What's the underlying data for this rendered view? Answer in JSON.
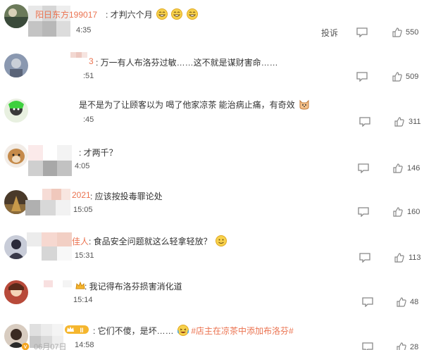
{
  "colors": {
    "accent": "#eb7350",
    "text": "#333333",
    "meta": "#555555",
    "icon": "#888888"
  },
  "comments": [
    {
      "username": "阳日东方199017",
      "text": "才判六个月",
      "time": "4:35",
      "likes": "550",
      "report_label": "投诉",
      "emojis": [
        "grin-emoji",
        "grin-emoji",
        "grin-emoji"
      ]
    },
    {
      "username": "3",
      "text": "万一有人布洛芬过敏……这不就是谋财害命……",
      "time": ":51",
      "likes": "509",
      "emojis": []
    },
    {
      "username": "",
      "text": "是不是为了让顾客以为 喝了他家凉茶 能治病止痛，有奇效",
      "time": ":45",
      "likes": "311",
      "emojis": [
        "cat-emoji"
      ]
    },
    {
      "username": "",
      "text": "才两千？",
      "time": "4:05",
      "likes": "146",
      "emojis": []
    },
    {
      "username": "2021",
      "text": "应该按投毒罪论处",
      "time": "15:05",
      "likes": "160",
      "emojis": []
    },
    {
      "username": "佳人",
      "text": "食品安全问题就这么轻拿轻放？",
      "time": "15:31",
      "likes": "113",
      "emojis": [
        "smile-emoji"
      ]
    },
    {
      "username": "",
      "text": "我记得布洛芬损害消化道",
      "time": "15:14",
      "likes": "48",
      "emojis": []
    },
    {
      "username": "",
      "text": "它们不傻，是坏……",
      "time_prefix": "06月07日",
      "time": "14:58",
      "likes": "28",
      "topic": "#店主在凉茶中添加布洛芬#",
      "badge_text": "II",
      "emojis": [
        "laugh-cry-emoji"
      ]
    }
  ]
}
